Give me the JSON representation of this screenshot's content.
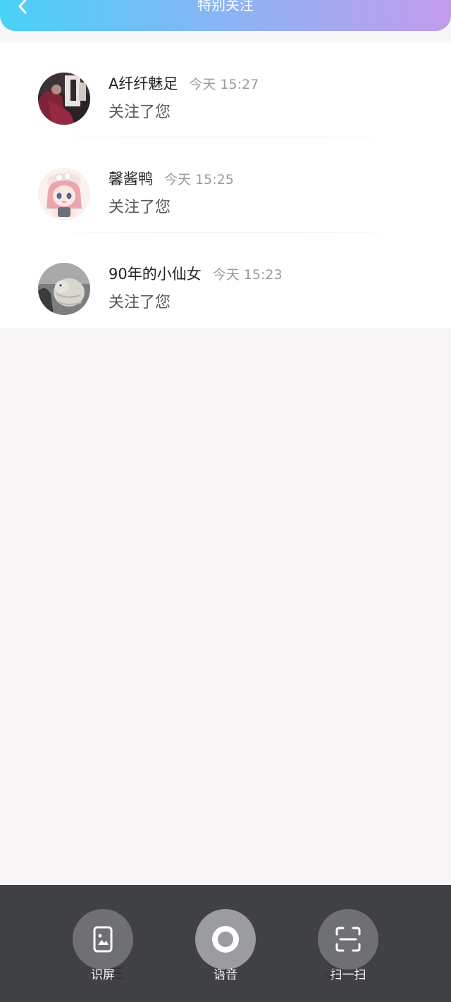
{
  "header": {
    "title": "特别关注",
    "back_icon": "chevron-left-icon",
    "gradient_colors": [
      "#48d2f8",
      "#8ab4f4",
      "#c39bec"
    ]
  },
  "notifications": [
    {
      "name": "A纤纤魅足",
      "time": "今天 15:27",
      "message": "关注了您"
    },
    {
      "name": "馨酱鸭",
      "time": "今天 15:25",
      "message": "关注了您"
    },
    {
      "name": "90年的小仙女",
      "time": "今天 15:23",
      "message": "关注了您"
    }
  ],
  "toolbar": {
    "items": [
      {
        "label": "识屏",
        "icon": "screen-recognition-icon"
      },
      {
        "label": "语音",
        "icon": "voice-icon"
      },
      {
        "label": "扫一扫",
        "icon": "scan-icon"
      }
    ]
  },
  "colors": {
    "background": "#f8f6f7",
    "toolbar": "#404145",
    "time_text": "#9a9a9a"
  }
}
